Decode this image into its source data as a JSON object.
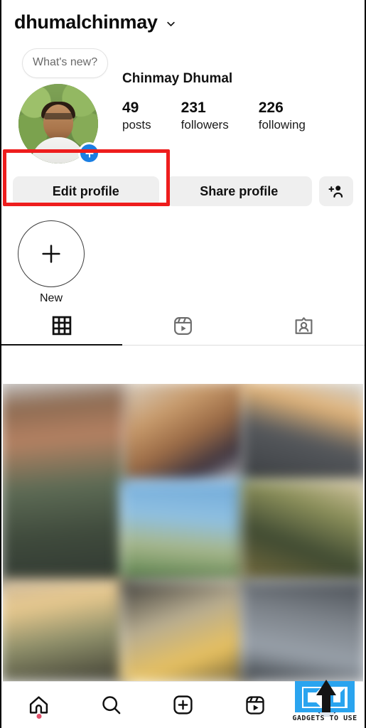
{
  "header": {
    "username": "dhumalchinmay",
    "dropdown_icon": "chevron-down-icon"
  },
  "profile": {
    "full_name": "Chinmay Dhumal",
    "avatar_alt": "profile-photo",
    "story_tooltip": "What's new?",
    "add_story_icon": "plus-badge-icon",
    "stats": [
      {
        "value": "49",
        "label": "posts"
      },
      {
        "value": "231",
        "label": "followers"
      },
      {
        "value": "226",
        "label": "following"
      }
    ]
  },
  "actions": {
    "edit_profile": "Edit profile",
    "share_profile": "Share profile",
    "add_person_icon": "add-person-icon"
  },
  "annotation": {
    "color": "#ee1d1d",
    "target": "Edit profile"
  },
  "highlights": [
    {
      "label": "New",
      "icon": "plus-icon"
    }
  ],
  "tabs": [
    {
      "name": "grid",
      "icon": "grid-icon",
      "active": true
    },
    {
      "name": "reels",
      "icon": "reels-icon",
      "active": false
    },
    {
      "name": "tagged",
      "icon": "tagged-icon",
      "active": false
    }
  ],
  "grid_posts": [
    {
      "id": "post-1",
      "span": 1
    },
    {
      "id": "post-2",
      "span": 2
    },
    {
      "id": "post-3",
      "span": 1
    },
    {
      "id": "post-4",
      "span": 1
    },
    {
      "id": "post-5",
      "span": 1
    },
    {
      "id": "post-6",
      "span": 1
    },
    {
      "id": "post-7",
      "span": 1
    },
    {
      "id": "post-8",
      "span": 1
    },
    {
      "id": "post-9",
      "span": 1
    }
  ],
  "bottom_nav": [
    {
      "name": "home",
      "icon": "home-icon",
      "badge": true
    },
    {
      "name": "search",
      "icon": "search-icon",
      "badge": false
    },
    {
      "name": "create",
      "icon": "plus-box-icon",
      "badge": false
    },
    {
      "name": "reels",
      "icon": "reels-icon",
      "badge": false
    },
    {
      "name": "profile",
      "icon": "avatar-icon",
      "badge": false
    }
  ],
  "watermark": {
    "text": "GADGETS TO USE",
    "color": "#2aa4ef"
  }
}
